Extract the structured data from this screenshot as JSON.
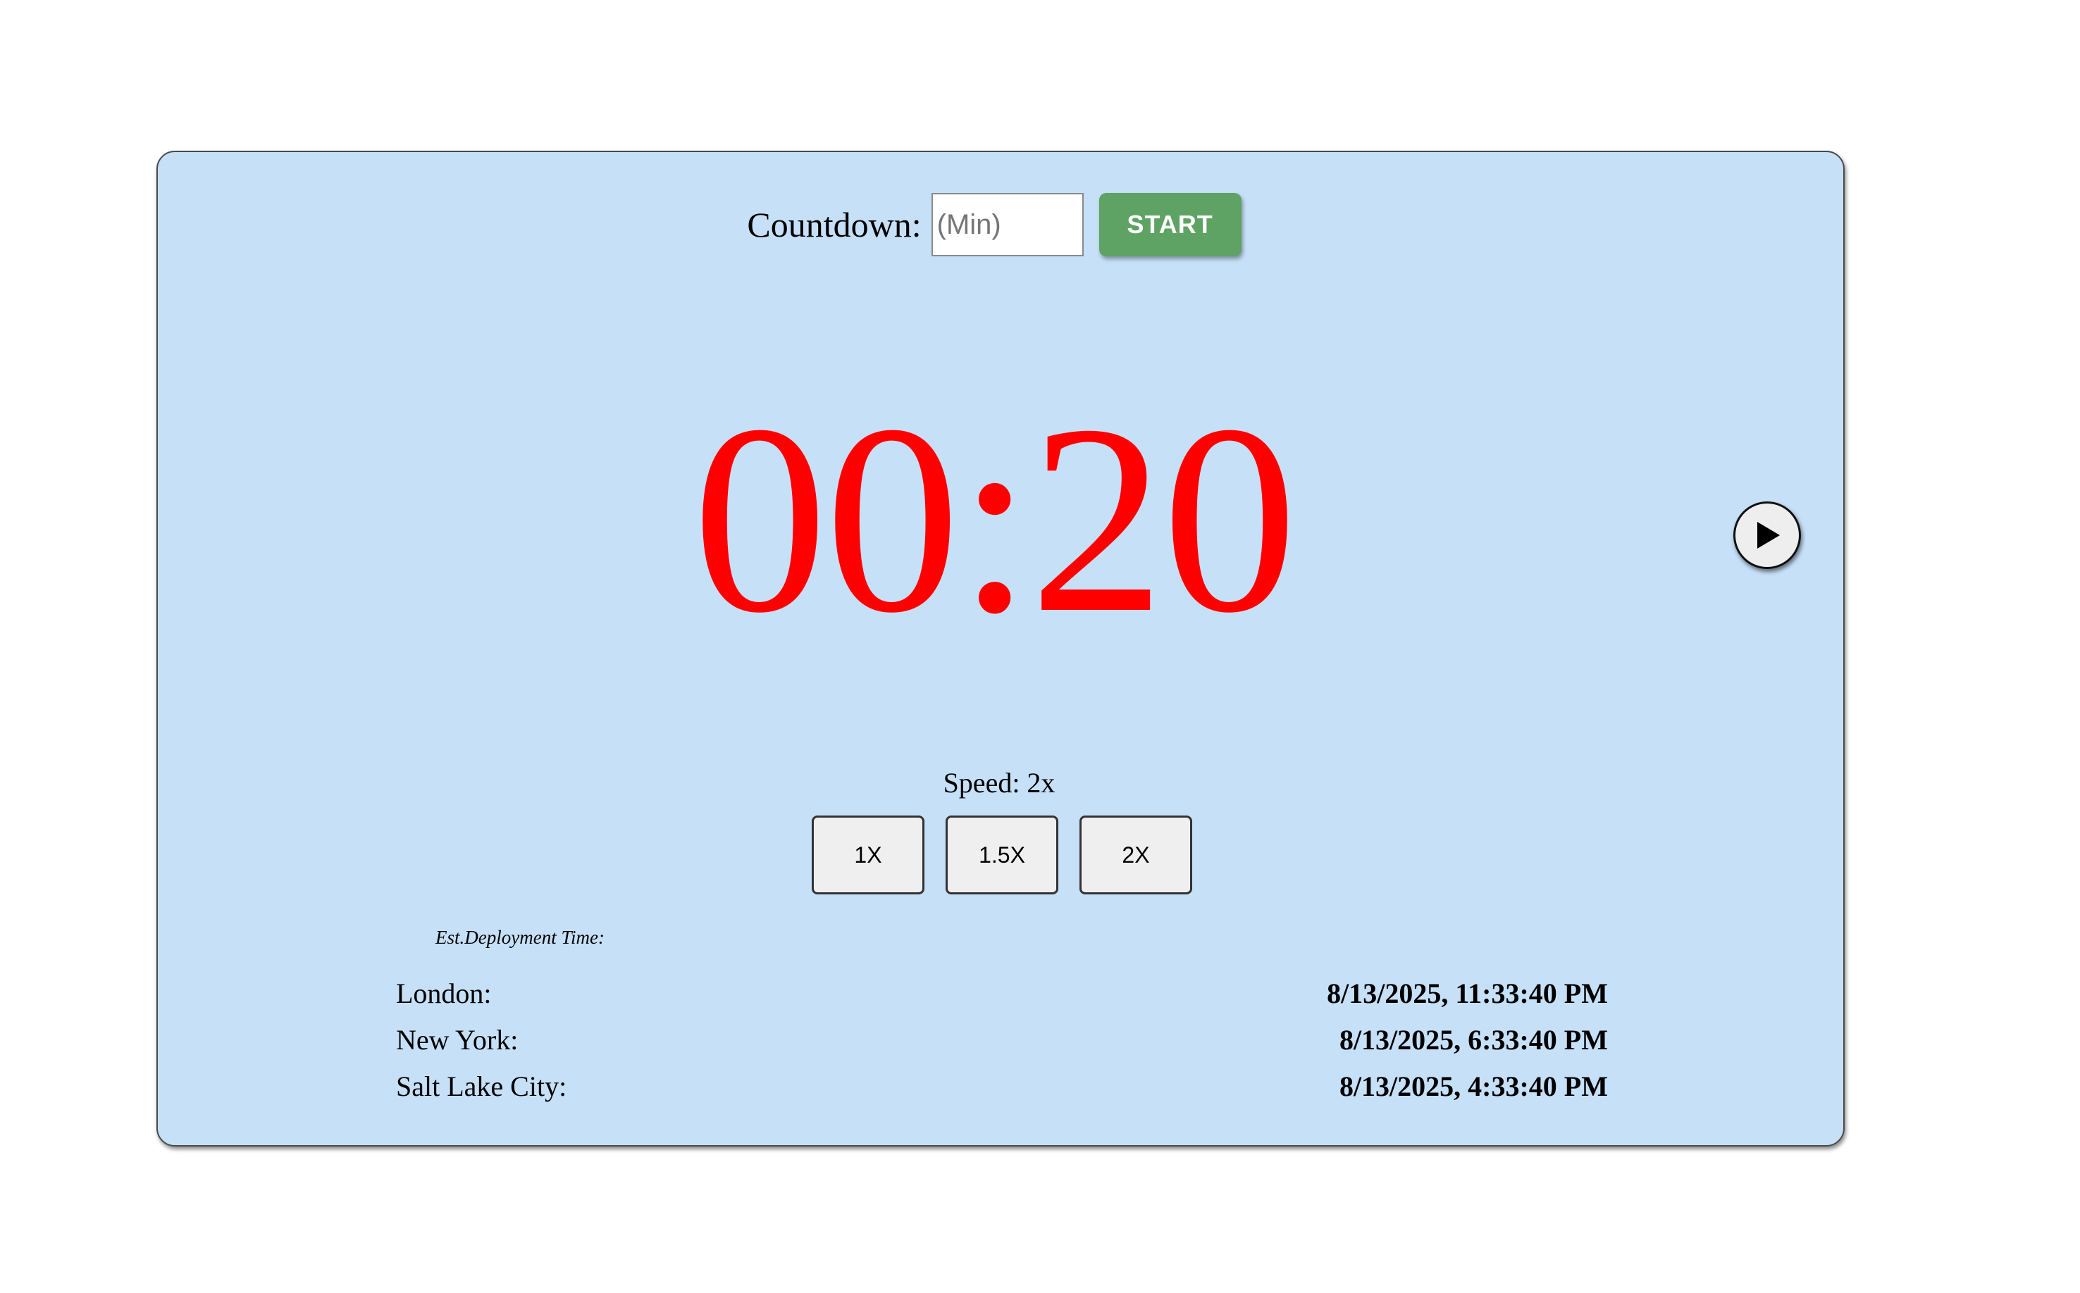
{
  "countdown": {
    "label": "Countdown:",
    "input_placeholder": "(Min)",
    "input_value": "",
    "start_label": "START"
  },
  "timer": {
    "display": "00:20",
    "color": "#ff0000"
  },
  "controls": {
    "play_icon": "play-icon"
  },
  "speed": {
    "label": "Speed: 2x",
    "options": [
      "1X",
      "1.5X",
      "2X"
    ]
  },
  "deployment": {
    "title": "Est.Deployment Time:",
    "locations": [
      {
        "city": "London:",
        "time": "8/13/2025, 11:33:40 PM"
      },
      {
        "city": "New York:",
        "time": "8/13/2025, 6:33:40 PM"
      },
      {
        "city": "Salt Lake City:",
        "time": "8/13/2025, 4:33:40 PM"
      }
    ]
  },
  "colors": {
    "panel_background": "#c6e0f8",
    "start_button": "#5ea363",
    "timer_text": "#ff0000"
  }
}
